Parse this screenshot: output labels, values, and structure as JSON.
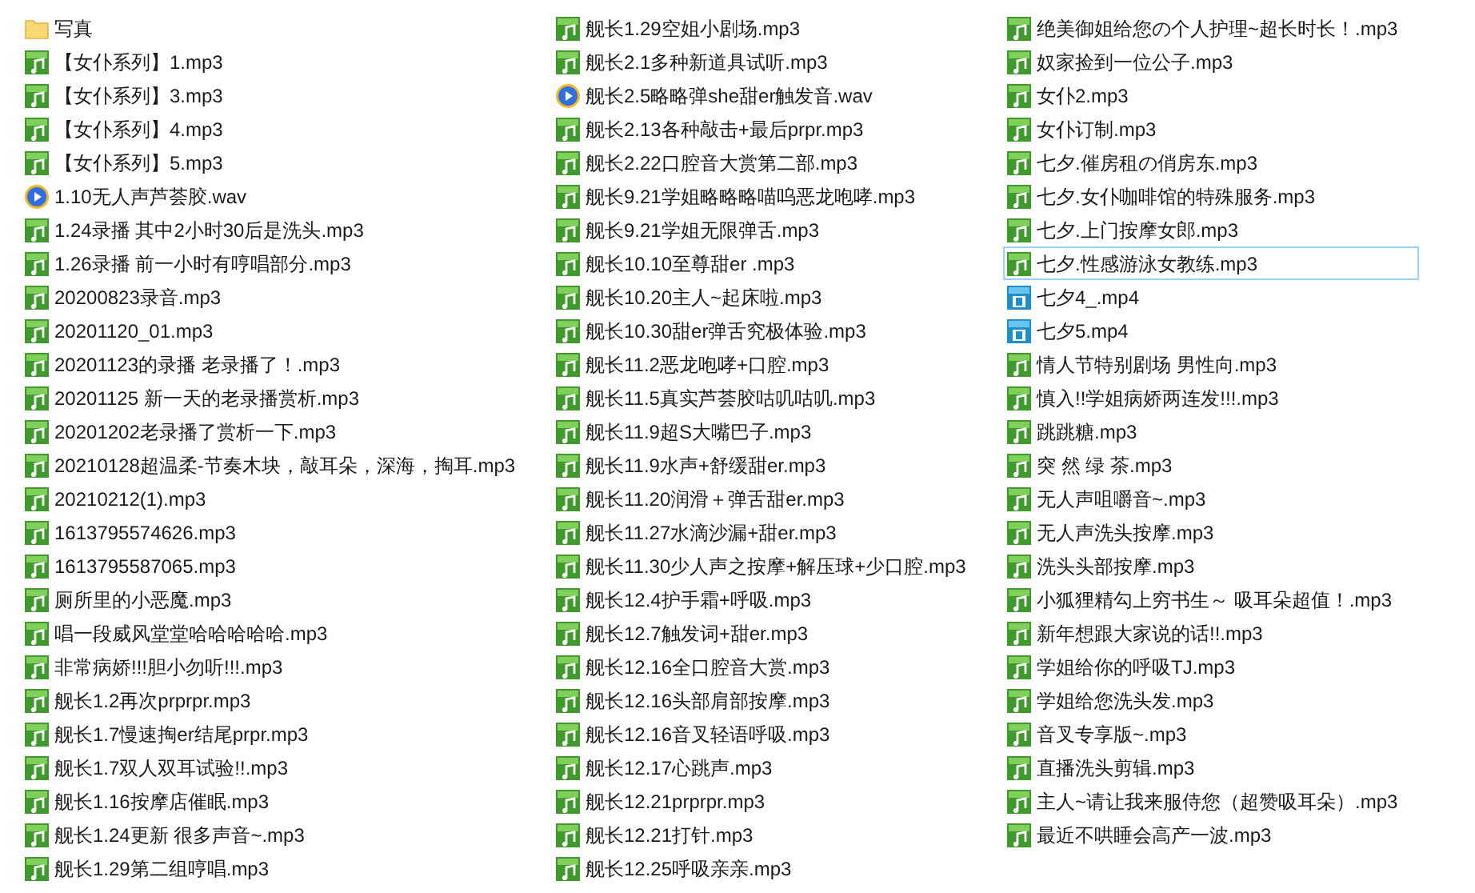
{
  "files": [
    {
      "name": "写真",
      "kind": "folder",
      "selected": false
    },
    {
      "name": "【女仆系列】1.mp3",
      "kind": "mp3",
      "selected": false
    },
    {
      "name": "【女仆系列】3.mp3",
      "kind": "mp3",
      "selected": false
    },
    {
      "name": "【女仆系列】4.mp3",
      "kind": "mp3",
      "selected": false
    },
    {
      "name": "【女仆系列】5.mp3",
      "kind": "mp3",
      "selected": false
    },
    {
      "name": "1.10无人声芦荟胶.wav",
      "kind": "wav",
      "selected": false
    },
    {
      "name": "1.24录播 其中2小时30后是洗头.mp3",
      "kind": "mp3",
      "selected": false
    },
    {
      "name": "1.26录播 前一小时有哼唱部分.mp3",
      "kind": "mp3",
      "selected": false
    },
    {
      "name": "20200823录音.mp3",
      "kind": "mp3",
      "selected": false
    },
    {
      "name": "20201120_01.mp3",
      "kind": "mp3",
      "selected": false
    },
    {
      "name": "20201123的录播 老录播了！.mp3",
      "kind": "mp3",
      "selected": false
    },
    {
      "name": "20201125 新一天的老录播赏析.mp3",
      "kind": "mp3",
      "selected": false
    },
    {
      "name": "20201202老录播了赏析一下.mp3",
      "kind": "mp3",
      "selected": false
    },
    {
      "name": "20210128超温柔-节奏木块，敲耳朵，深海，掏耳.mp3",
      "kind": "mp3",
      "selected": false
    },
    {
      "name": "20210212(1).mp3",
      "kind": "mp3",
      "selected": false
    },
    {
      "name": "1613795574626.mp3",
      "kind": "mp3",
      "selected": false
    },
    {
      "name": "1613795587065.mp3",
      "kind": "mp3",
      "selected": false
    },
    {
      "name": "厕所里的小恶魔.mp3",
      "kind": "mp3",
      "selected": false
    },
    {
      "name": "唱一段威风堂堂哈哈哈哈哈.mp3",
      "kind": "mp3",
      "selected": false
    },
    {
      "name": "非常病娇!!!胆小勿听!!!.mp3",
      "kind": "mp3",
      "selected": false
    },
    {
      "name": "舰长1.2再次prprpr.mp3",
      "kind": "mp3",
      "selected": false
    },
    {
      "name": "舰长1.7慢速掏er结尾prpr.mp3",
      "kind": "mp3",
      "selected": false
    },
    {
      "name": "舰长1.7双人双耳试验!!.mp3",
      "kind": "mp3",
      "selected": false
    },
    {
      "name": "舰长1.16按摩店催眠.mp3",
      "kind": "mp3",
      "selected": false
    },
    {
      "name": "舰长1.24更新 很多声音~.mp3",
      "kind": "mp3",
      "selected": false
    },
    {
      "name": "舰长1.29第二组哼唱.mp3",
      "kind": "mp3",
      "selected": false
    },
    {
      "name": "舰长1.29空姐小剧场.mp3",
      "kind": "mp3",
      "selected": false
    },
    {
      "name": "舰长2.1多种新道具试听.mp3",
      "kind": "mp3",
      "selected": false
    },
    {
      "name": "舰长2.5略略弹she甜er触发音.wav",
      "kind": "wav",
      "selected": false
    },
    {
      "name": "舰长2.13各种敲击+最后prpr.mp3",
      "kind": "mp3",
      "selected": false
    },
    {
      "name": "舰长2.22口腔音大赏第二部.mp3",
      "kind": "mp3",
      "selected": false
    },
    {
      "name": "舰长9.21学姐略略略喵呜恶龙咆哮.mp3",
      "kind": "mp3",
      "selected": false
    },
    {
      "name": "舰长9.21学姐无限弹舌.mp3",
      "kind": "mp3",
      "selected": false
    },
    {
      "name": "舰长10.10至尊甜er .mp3",
      "kind": "mp3",
      "selected": false
    },
    {
      "name": "舰长10.20主人~起床啦.mp3",
      "kind": "mp3",
      "selected": false
    },
    {
      "name": "舰长10.30甜er弹舌究极体验.mp3",
      "kind": "mp3",
      "selected": false
    },
    {
      "name": "舰长11.2恶龙咆哮+口腔.mp3",
      "kind": "mp3",
      "selected": false
    },
    {
      "name": "舰长11.5真实芦荟胶咕叽咕叽.mp3",
      "kind": "mp3",
      "selected": false
    },
    {
      "name": "舰长11.9超S大嘴巴子.mp3",
      "kind": "mp3",
      "selected": false
    },
    {
      "name": "舰长11.9水声+舒缓甜er.mp3",
      "kind": "mp3",
      "selected": false
    },
    {
      "name": "舰长11.20润滑＋弹舌甜er.mp3",
      "kind": "mp3",
      "selected": false
    },
    {
      "name": "舰长11.27水滴沙漏+甜er.mp3",
      "kind": "mp3",
      "selected": false
    },
    {
      "name": "舰长11.30少人声之按摩+解压球+少口腔.mp3",
      "kind": "mp3",
      "selected": false
    },
    {
      "name": "舰长12.4护手霜+呼吸.mp3",
      "kind": "mp3",
      "selected": false
    },
    {
      "name": "舰长12.7触发词+甜er.mp3",
      "kind": "mp3",
      "selected": false
    },
    {
      "name": "舰长12.16全口腔音大赏.mp3",
      "kind": "mp3",
      "selected": false
    },
    {
      "name": "舰长12.16头部肩部按摩.mp3",
      "kind": "mp3",
      "selected": false
    },
    {
      "name": "舰长12.16音叉轻语呼吸.mp3",
      "kind": "mp3",
      "selected": false
    },
    {
      "name": "舰长12.17心跳声.mp3",
      "kind": "mp3",
      "selected": false
    },
    {
      "name": "舰长12.21prprpr.mp3",
      "kind": "mp3",
      "selected": false
    },
    {
      "name": "舰长12.21打针.mp3",
      "kind": "mp3",
      "selected": false
    },
    {
      "name": "舰长12.25呼吸亲亲.mp3",
      "kind": "mp3",
      "selected": false
    },
    {
      "name": "绝美御姐给您の个人护理~超长时长！.mp3",
      "kind": "mp3",
      "selected": false
    },
    {
      "name": "奴家捡到一位公子.mp3",
      "kind": "mp3",
      "selected": false
    },
    {
      "name": "女仆2.mp3",
      "kind": "mp3",
      "selected": false
    },
    {
      "name": "女仆订制.mp3",
      "kind": "mp3",
      "selected": false
    },
    {
      "name": "七夕.催房租の俏房东.mp3",
      "kind": "mp3",
      "selected": false
    },
    {
      "name": "七夕.女仆咖啡馆的特殊服务.mp3",
      "kind": "mp3",
      "selected": false
    },
    {
      "name": "七夕.上门按摩女郎.mp3",
      "kind": "mp3",
      "selected": false
    },
    {
      "name": "七夕.性感游泳女教练.mp3",
      "kind": "mp3",
      "selected": true
    },
    {
      "name": "七夕4_.mp4",
      "kind": "mp4",
      "selected": false
    },
    {
      "name": "七夕5.mp4",
      "kind": "mp4",
      "selected": false
    },
    {
      "name": "情人节特别剧场 男性向.mp3",
      "kind": "mp3",
      "selected": false
    },
    {
      "name": "慎入!!学姐病娇两连发!!!.mp3",
      "kind": "mp3",
      "selected": false
    },
    {
      "name": "跳跳糖.mp3",
      "kind": "mp3",
      "selected": false
    },
    {
      "name": "突 然 绿 茶.mp3",
      "kind": "mp3",
      "selected": false
    },
    {
      "name": "无人声咀嚼音~.mp3",
      "kind": "mp3",
      "selected": false
    },
    {
      "name": "无人声洗头按摩.mp3",
      "kind": "mp3",
      "selected": false
    },
    {
      "name": "洗头头部按摩.mp3",
      "kind": "mp3",
      "selected": false
    },
    {
      "name": "小狐狸精勾上穷书生～ 吸耳朵超值！.mp3",
      "kind": "mp3",
      "selected": false
    },
    {
      "name": "新年想跟大家说的话!!.mp3",
      "kind": "mp3",
      "selected": false
    },
    {
      "name": "学姐给你的呼吸TJ.mp3",
      "kind": "mp3",
      "selected": false
    },
    {
      "name": "学姐给您洗头发.mp3",
      "kind": "mp3",
      "selected": false
    },
    {
      "name": "音叉专享版~.mp3",
      "kind": "mp3",
      "selected": false
    },
    {
      "name": "直播洗头剪辑.mp3",
      "kind": "mp3",
      "selected": false
    },
    {
      "name": "主人~请让我来服侍您（超赞吸耳朵）.mp3",
      "kind": "mp3",
      "selected": false
    },
    {
      "name": "最近不哄睡会高产一波.mp3",
      "kind": "mp3",
      "selected": false
    }
  ]
}
